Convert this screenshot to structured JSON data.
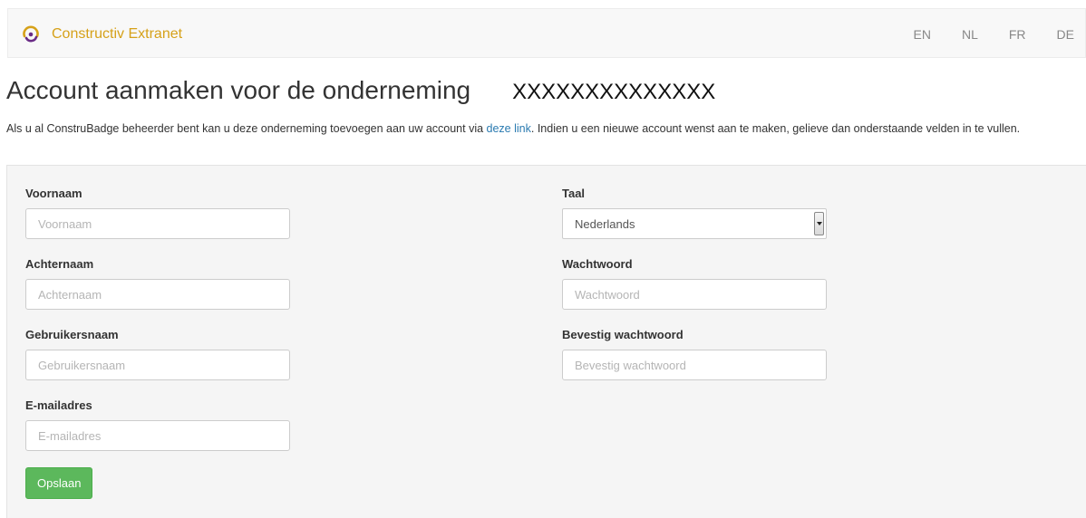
{
  "navbar": {
    "brand": "Constructiv Extranet",
    "logo_icon": "constructiv-logo-icon",
    "languages": [
      "EN",
      "NL",
      "FR",
      "DE"
    ]
  },
  "page": {
    "title": "Account aanmaken voor de onderneming",
    "company": "XXXXXXXXXXXXXX",
    "intro_before_link": "Als u al ConstruBadge beheerder bent kan u deze onderneming toevoegen aan uw account via ",
    "intro_link": "deze link",
    "intro_after_link": ". Indien u een nieuwe account wenst aan te maken, gelieve dan onderstaande velden in te vullen."
  },
  "form": {
    "first_name": {
      "label": "Voornaam",
      "placeholder": "Voornaam",
      "value": ""
    },
    "last_name": {
      "label": "Achternaam",
      "placeholder": "Achternaam",
      "value": ""
    },
    "username": {
      "label": "Gebruikersnaam",
      "placeholder": "Gebruikersnaam",
      "value": ""
    },
    "email": {
      "label": "E-mailadres",
      "placeholder": "E-mailadres",
      "value": ""
    },
    "language": {
      "label": "Taal",
      "selected": "Nederlands"
    },
    "password": {
      "label": "Wachtwoord",
      "placeholder": "Wachtwoord",
      "value": ""
    },
    "confirm_password": {
      "label": "Bevestig wachtwoord",
      "placeholder": "Bevestig wachtwoord",
      "value": ""
    },
    "save_label": "Opslaan"
  },
  "colors": {
    "brand": "#d6a119",
    "link": "#2a7ab0",
    "save_button": "#5cb85c",
    "panel_bg": "#f5f5f5"
  }
}
